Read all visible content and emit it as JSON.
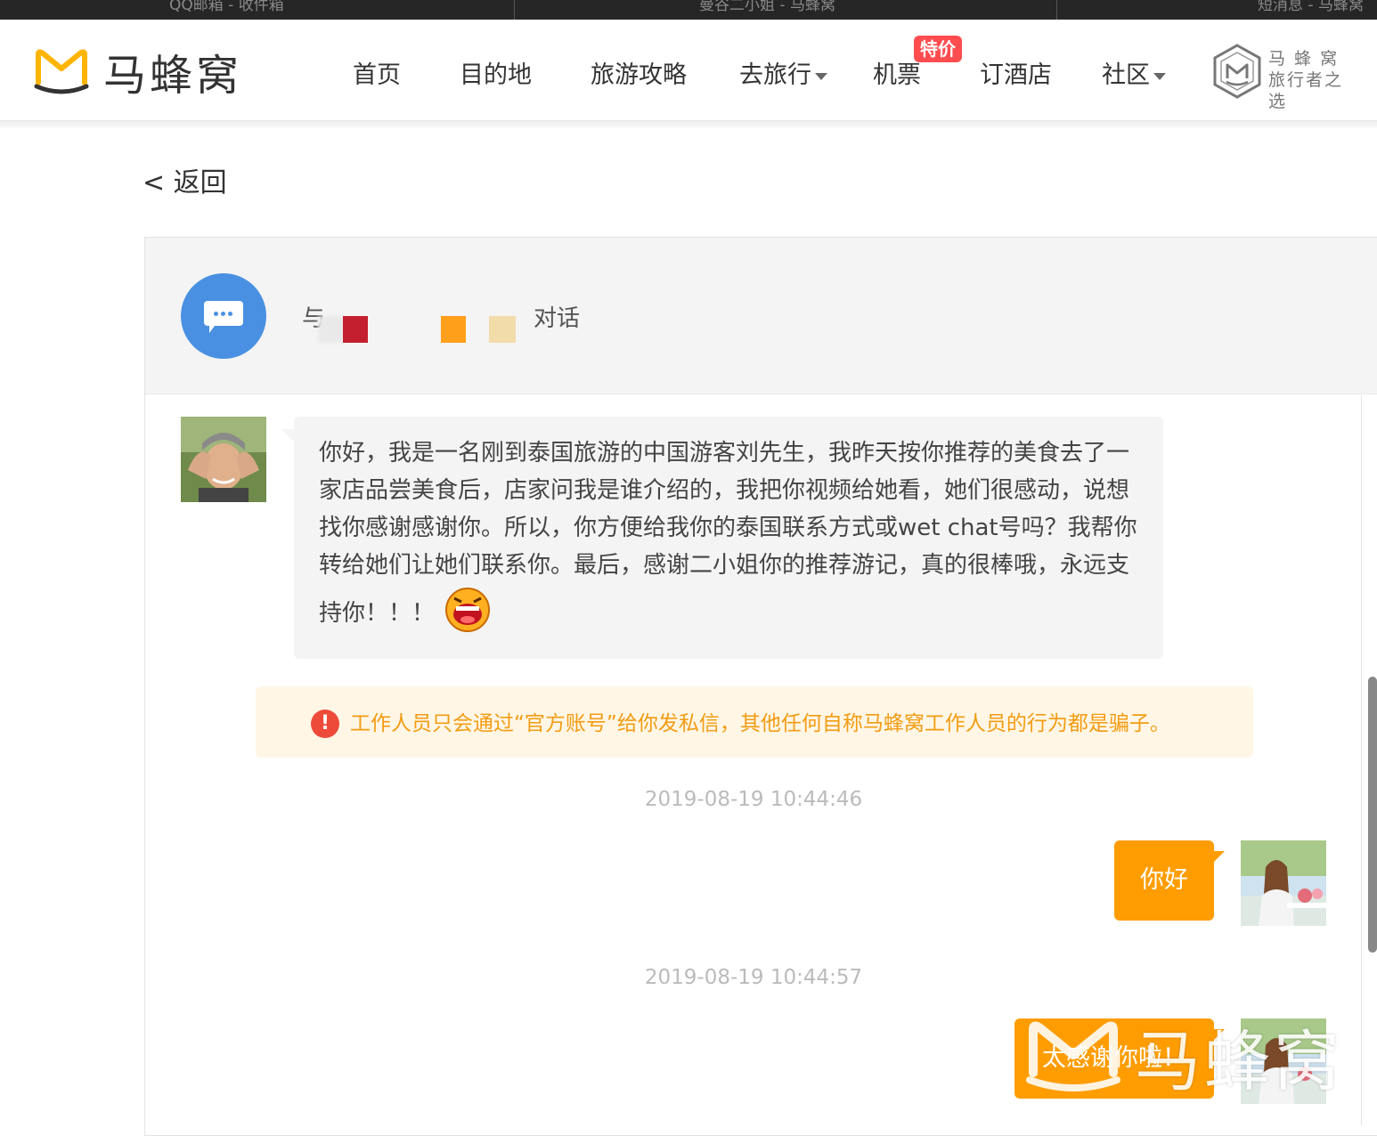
{
  "browser_tabs": [
    "QQ邮箱 - 收件箱",
    "曼谷二小姐 - 马蜂窝",
    "短消息 - 马蜂窝"
  ],
  "header": {
    "logo_text": "马蜂窝",
    "nav": [
      {
        "label": "首页",
        "has_dropdown": false
      },
      {
        "label": "目的地",
        "has_dropdown": false
      },
      {
        "label": "旅游攻略",
        "has_dropdown": false
      },
      {
        "label": "去旅行",
        "has_dropdown": true
      },
      {
        "label": "机票",
        "has_dropdown": false,
        "badge": "特价"
      },
      {
        "label": "订酒店",
        "has_dropdown": false
      },
      {
        "label": "社区",
        "has_dropdown": true
      }
    ],
    "slogan_line1": "马 蜂 窝",
    "slogan_line2": "旅行者之选"
  },
  "back_label": "< 返回",
  "conversation": {
    "title_prefix": "与",
    "title_suffix": "对话",
    "redaction_colors": [
      "#e9e9e9",
      "#c41f2f",
      "#ff9f1a",
      "#f2dcaa"
    ],
    "incoming_message": "你好，我是一名刚到泰国旅游的中国游客刘先生，我昨天按你推荐的美食去了一家店品尝美食后，店家问我是谁介绍的，我把你视频给她看，她们很感动，说想找你感谢感谢你。所以，你方便给我你的泰国联系方式或wet chat号吗？我帮你转给她们让她们联系你。最后，感谢二小姐你的推荐游记，真的很棒哦，永远支持你！！！",
    "warning": "工作人员只会通过“官方账号”给你发私信，其他任何自称马蜂窝工作人员的行为都是骗子。",
    "replies": [
      {
        "time": "2019-08-19 10:44:46",
        "text": "你好"
      },
      {
        "time": "2019-08-19 10:44:57",
        "text": "太感谢你啦！"
      }
    ]
  },
  "watermark_text": "马蜂窝",
  "colors": {
    "brand": "#ffb400",
    "bubble_out": "#ff9d00",
    "warning_text": "#f39c12",
    "badge": "#ff4d4f"
  }
}
